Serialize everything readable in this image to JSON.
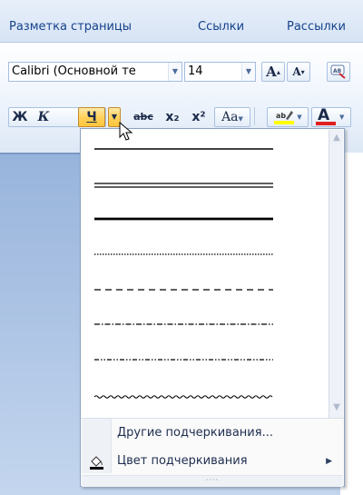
{
  "ribbon_tabs": [
    "Разметка страницы",
    "Ссылки",
    "Рассылки"
  ],
  "font": {
    "name_value": "Calibri (Основной те",
    "size_value": "14"
  },
  "format_buttons": {
    "bold": "Ж",
    "italic": "К",
    "underline": "Ч",
    "strike": "abc",
    "subscript": "x₂",
    "superscript": "x²",
    "change_case": "Aa",
    "grow_font": "A",
    "shrink_font": "A",
    "font_color": "A"
  },
  "colors": {
    "highlight": "#ffff00",
    "font_color": "#e02020",
    "accent": "#15428b"
  },
  "underline_styles": [
    "single",
    "double",
    "thick",
    "dotted",
    "dashed",
    "dash-dot",
    "dash-dot-dot",
    "wave"
  ],
  "menu": {
    "more_underlines": "Другие подчеркивания...",
    "underline_color": "Цвет подчеркивания"
  },
  "icons": {
    "underline_color": "paint-bucket-icon",
    "clear_formatting": "clear-format-icon",
    "cursor": "mouse-pointer-icon"
  }
}
